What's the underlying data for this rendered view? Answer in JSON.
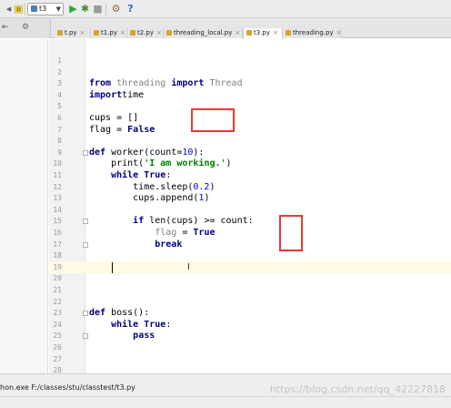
{
  "toolbar": {
    "run_config": "t3",
    "help_label": "?"
  },
  "project_tools": {
    "settings_glyph": "⚙",
    "collapse_glyph": "⇤"
  },
  "tabs": [
    {
      "label": "t.py",
      "active": false
    },
    {
      "label": "t1.py",
      "active": false
    },
    {
      "label": "t2.py",
      "active": false
    },
    {
      "label": "threading_local.py",
      "active": false
    },
    {
      "label": "t3.py",
      "active": true
    },
    {
      "label": "threading.py",
      "active": false
    }
  ],
  "editor": {
    "caret_line": 19,
    "lines": [
      {
        "n": "1",
        "t": []
      },
      {
        "n": "2",
        "t": []
      },
      {
        "n": "3",
        "t": [
          [
            "kw",
            "from"
          ],
          [
            "dim",
            " threading "
          ],
          [
            "kw",
            "import"
          ],
          [
            "dim",
            " Thread"
          ]
        ]
      },
      {
        "n": "4",
        "t": [
          [
            "kw",
            "import"
          ],
          [
            "",
            "time"
          ]
        ]
      },
      {
        "n": "5",
        "t": []
      },
      {
        "n": "6",
        "t": [
          [
            "",
            "cups = []"
          ]
        ]
      },
      {
        "n": "7",
        "t": [
          [
            "",
            "flag = "
          ],
          [
            "kw",
            "False"
          ]
        ]
      },
      {
        "n": "8",
        "t": []
      },
      {
        "n": "9",
        "t": [
          [
            "kw",
            "def"
          ],
          [
            "",
            " worker(count="
          ],
          [
            "num",
            "10"
          ],
          [
            "",
            "):"
          ]
        ]
      },
      {
        "n": "10",
        "t": [
          [
            "",
            "    print("
          ],
          [
            "str",
            "'I am working.'"
          ],
          [
            "",
            ")"
          ]
        ]
      },
      {
        "n": "11",
        "t": [
          [
            "",
            "    "
          ],
          [
            "kw",
            "while"
          ],
          [
            "kw",
            " True"
          ],
          [
            "",
            ":"
          ]
        ]
      },
      {
        "n": "12",
        "t": [
          [
            "",
            "        time.sleep("
          ],
          [
            "num",
            "0.2"
          ],
          [
            "",
            ")"
          ]
        ]
      },
      {
        "n": "13",
        "t": [
          [
            "",
            "        cups.append("
          ],
          [
            "num",
            "1"
          ],
          [
            "",
            ")"
          ]
        ]
      },
      {
        "n": "14",
        "t": []
      },
      {
        "n": "15",
        "t": [
          [
            "",
            "        "
          ],
          [
            "kw",
            "if"
          ],
          [
            "",
            " len(cups) >= count:"
          ]
        ]
      },
      {
        "n": "16",
        "t": [
          [
            "",
            "            "
          ],
          [
            "dim",
            "flag"
          ],
          [
            "",
            " = "
          ],
          [
            "kw",
            "True"
          ]
        ]
      },
      {
        "n": "17",
        "t": [
          [
            "",
            "            "
          ],
          [
            "kw",
            "break"
          ]
        ]
      },
      {
        "n": "18",
        "t": []
      },
      {
        "n": "19",
        "t": []
      },
      {
        "n": "20",
        "t": []
      },
      {
        "n": "21",
        "t": []
      },
      {
        "n": "22",
        "t": []
      },
      {
        "n": "23",
        "t": [
          [
            "kw",
            "def"
          ],
          [
            "",
            " boss():"
          ]
        ]
      },
      {
        "n": "24",
        "t": [
          [
            "",
            "    "
          ],
          [
            "kw",
            "while"
          ],
          [
            "kw",
            " True"
          ],
          [
            "",
            ":"
          ]
        ]
      },
      {
        "n": "25",
        "t": [
          [
            "",
            "        "
          ],
          [
            "kw",
            "pass"
          ]
        ]
      },
      {
        "n": "26",
        "t": []
      },
      {
        "n": "27",
        "t": []
      },
      {
        "n": "28",
        "t": []
      }
    ]
  },
  "status": {
    "path": "hon.exe F:/classes/stu/classtest/t3.py",
    "watermark": "https://blog.csdn.net/qq_42227818"
  }
}
